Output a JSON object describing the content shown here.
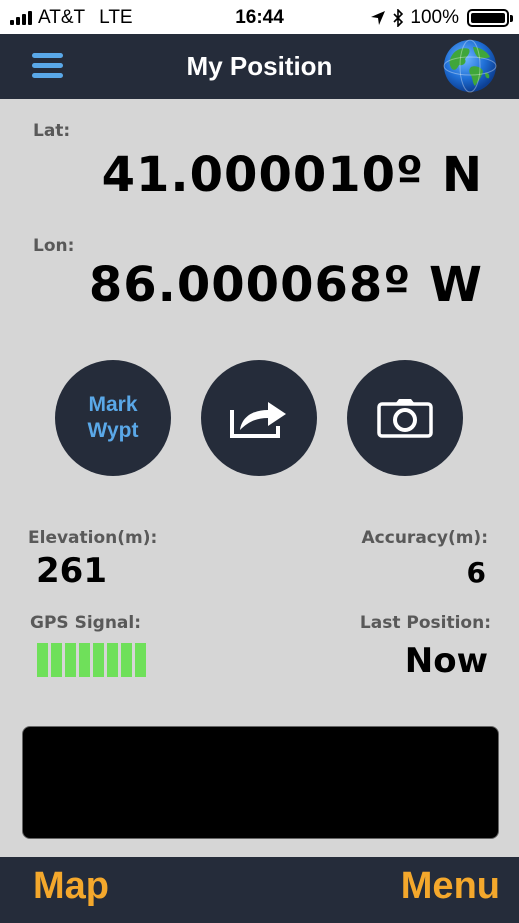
{
  "status_bar": {
    "carrier": "AT&T",
    "network": "LTE",
    "time": "16:44",
    "battery_percent": "100%",
    "signal_level": 4,
    "icons": [
      "cellular-signal-icon",
      "location-arrow-icon",
      "bluetooth-icon",
      "battery-icon"
    ]
  },
  "nav": {
    "title": "My Position",
    "left_icon": "hamburger-menu-icon",
    "right_icon": "globe-icon"
  },
  "position": {
    "lat_label": "Lat:",
    "lat_value": "41.000010º N",
    "lon_label": "Lon:",
    "lon_value": "86.000068º W"
  },
  "actions": {
    "mark_line1": "Mark",
    "mark_line2": "Wypt",
    "share_icon": "share-arrow-icon",
    "camera_icon": "camera-icon"
  },
  "stats": {
    "elevation_label": "Elevation(m):",
    "elevation_value": "261",
    "accuracy_label": "Accuracy(m):",
    "accuracy_value": "6",
    "gps_label": "GPS Signal:",
    "gps_signal_bars": 8,
    "last_position_label": "Last Position:",
    "last_position_value": "Now"
  },
  "bottom": {
    "left_label": "Map",
    "right_label": "Menu"
  },
  "colors": {
    "dark_bar": "#252c3a",
    "accent_blue": "#5aa8e8",
    "accent_orange": "#f4a82c",
    "signal_green": "#6fe05a",
    "background": "#d6d6d6"
  }
}
